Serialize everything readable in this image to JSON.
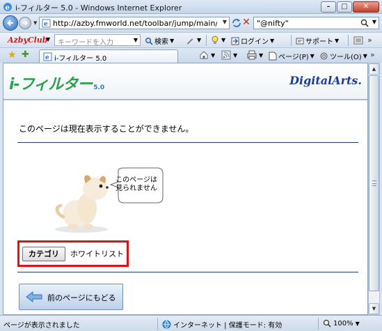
{
  "window": {
    "title": "i-フィルター 5.0 - Windows Internet Explorer",
    "minimize_glyph": "–",
    "maximize_glyph": "□",
    "close_glyph": "✕"
  },
  "addressbar": {
    "url": "http://azby.fmworld.net/toolbar/jump/main/index",
    "search_text": "\"@nifty\""
  },
  "toolbar": {
    "brand": "AzbyClub",
    "keyword_placeholder": "キーワードを入力",
    "search_label": "検索",
    "login_label": "ログイン",
    "support_label": "サポート"
  },
  "tabs": {
    "active_tab_label": "i-フィルター 5.0",
    "page_menu_label": "ページ(P)",
    "tools_menu_label": "ツール(O)"
  },
  "page": {
    "logo_text": "i-フィルター",
    "logo_version": "5.0",
    "vendor_logo": "DigitalArts.",
    "message": "このページは現在表示することができません。",
    "bubble_line1": "このページは",
    "bubble_line2": "見られません",
    "category_button": "カテゴリ",
    "category_value": "ホワイトリスト",
    "back_button": "前のページにもどる"
  },
  "statusbar": {
    "status_text": "ページが表示されました",
    "zone_text": "インターネット | 保護モード: 有効",
    "zoom": "100%"
  },
  "colors": {
    "accent": "#1d3f8f",
    "highlight_box": "#e01010",
    "logo_green": "#2aa24a"
  }
}
